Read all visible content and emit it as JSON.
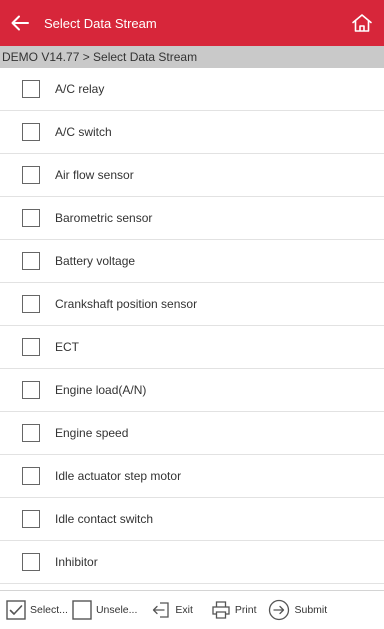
{
  "header": {
    "title": "Select Data Stream",
    "back_icon": "back-arrow-icon",
    "home_icon": "home-icon"
  },
  "breadcrumb": "DEMO V14.77 > Select Data Stream",
  "items": [
    {
      "label": "A/C relay",
      "checked": false
    },
    {
      "label": "A/C switch",
      "checked": false
    },
    {
      "label": "Air flow sensor",
      "checked": false
    },
    {
      "label": "Barometric sensor",
      "checked": false
    },
    {
      "label": "Battery voltage",
      "checked": false
    },
    {
      "label": "Crankshaft position sensor",
      "checked": false
    },
    {
      "label": "ECT",
      "checked": false
    },
    {
      "label": "Engine load(A/N)",
      "checked": false
    },
    {
      "label": "Engine speed",
      "checked": false
    },
    {
      "label": "Idle actuator step motor",
      "checked": false
    },
    {
      "label": "Idle contact switch",
      "checked": false
    },
    {
      "label": "Inhibitor",
      "checked": false
    }
  ],
  "footer": {
    "select_label": "Select...",
    "unselect_label": "Unsele...",
    "exit_label": "Exit",
    "print_label": "Print",
    "submit_label": "Submit"
  },
  "colors": {
    "header_bg": "#d7263a",
    "breadcrumb_bg": "#c9c9c9"
  }
}
